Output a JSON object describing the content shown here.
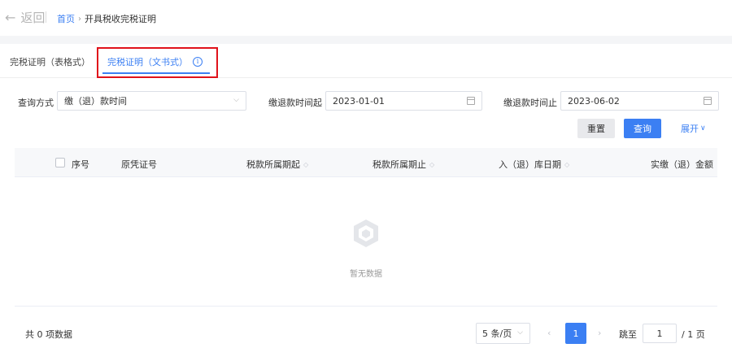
{
  "header": {
    "back_label": "返回",
    "breadcrumb": {
      "home": "首页",
      "current": "开具税收完税证明"
    }
  },
  "tabs": [
    {
      "label": "完税证明（表格式）",
      "active": false
    },
    {
      "label": "完税证明（文书式）",
      "active": true
    }
  ],
  "filters": {
    "query_method_label": "查询方式",
    "query_method_value": "缴（退）款时间",
    "start_label": "缴退款时间起",
    "start_value": "2023-01-01",
    "end_label": "缴退款时间止",
    "end_value": "2023-06-02",
    "reset_label": "重置",
    "query_label": "查询",
    "expand_label": "展开"
  },
  "table": {
    "columns": [
      "序号",
      "原凭证号",
      "税款所属期起",
      "税款所属期止",
      "入（退）库日期",
      "实缴（退）金额"
    ],
    "rows": [],
    "empty_text": "暂无数据"
  },
  "pagination": {
    "total_text": "共 0 项数据",
    "page_size": "5 条/页",
    "current_page": "1",
    "jump_label": "跳至",
    "jump_value": "1",
    "total_pages_text": "/ 1 页"
  },
  "colors": {
    "accent": "#3b7ff3",
    "highlight": "#e0121b"
  }
}
